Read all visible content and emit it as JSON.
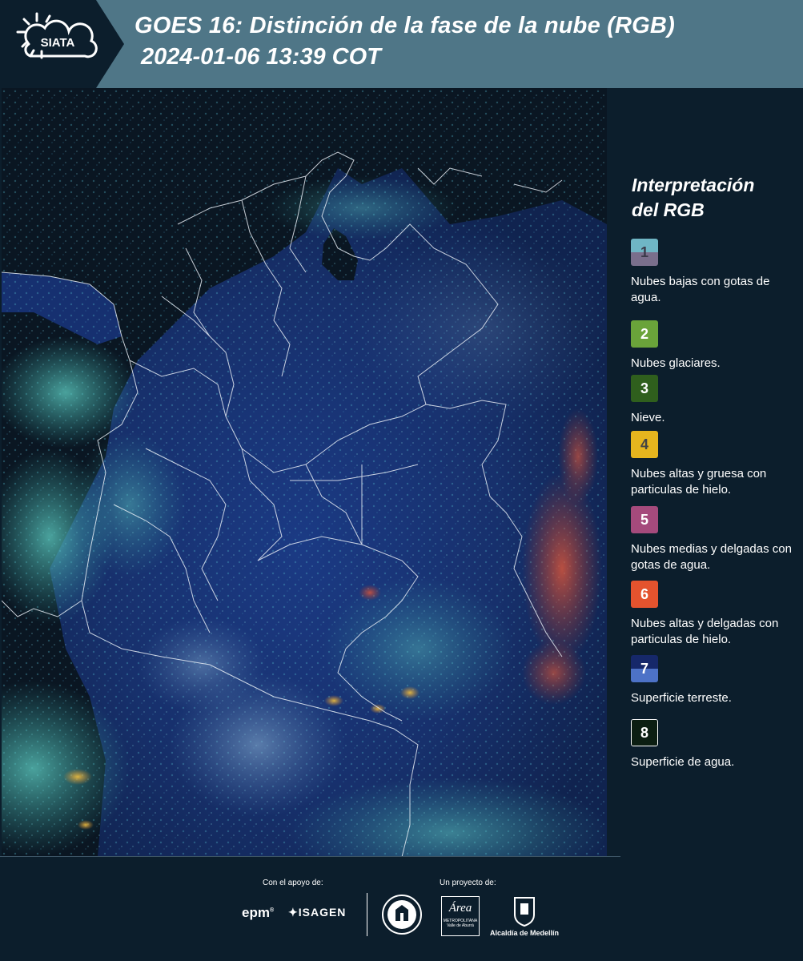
{
  "header": {
    "logo_text": "SIATA",
    "title_line1": "GOES 16: Distinción de la fase de la nube (RGB)",
    "title_line2": "2024-01-06 13:39 COT"
  },
  "legend": {
    "title_line1": "Interpretación",
    "title_line2": "del RGB",
    "items": [
      {
        "num": "1",
        "label": "Nubes bajas con gotas de agua.",
        "color_top": "#6fb6c5",
        "color_bottom": "#7a6f8c",
        "num_color": "#3b3b4a"
      },
      {
        "num": "2",
        "label": "Nubes glaciares.",
        "color_top": "#6aa33a",
        "color_bottom": "#6aa33a",
        "num_color": "#ffffff"
      },
      {
        "num": "3",
        "label": "Nieve.",
        "color_top": "#2f5f1d",
        "color_bottom": "#2f5f1d",
        "num_color": "#ffffff"
      },
      {
        "num": "4",
        "label": "Nubes altas y gruesa con particulas de hielo.",
        "color_top": "#e6b51e",
        "color_bottom": "#e6b51e",
        "num_color": "#444444"
      },
      {
        "num": "5",
        "label": "Nubes medias y delgadas con gotas de agua.",
        "color_top": "#a54a7c",
        "color_bottom": "#a54a7c",
        "num_color": "#ffffff"
      },
      {
        "num": "6",
        "label": "Nubes altas y delgadas con particulas de hielo.",
        "color_top": "#e4532e",
        "color_bottom": "#e4532e",
        "num_color": "#ffffff"
      },
      {
        "num": "7",
        "label": "Superficie terreste.",
        "color_top": "#16286a",
        "color_bottom": "#4d72c7",
        "num_color": "#ffffff"
      },
      {
        "num": "8",
        "label": "Superficie de agua.",
        "color_top": "#0c1e12",
        "color_bottom": "#0c1e12",
        "num_color": "#ffffff"
      }
    ]
  },
  "footer": {
    "support_caption": "Con el apoyo de:",
    "project_caption": "Un proyecto de:",
    "sponsor1": "epm",
    "sponsor2": "ISAGEN",
    "partner_area_1": "Área",
    "partner_area_2": "METROPOLITANA",
    "partner_area_3": "Valle de Aburrá",
    "partner_alcaldia": "Alcaldía de Medellín"
  }
}
